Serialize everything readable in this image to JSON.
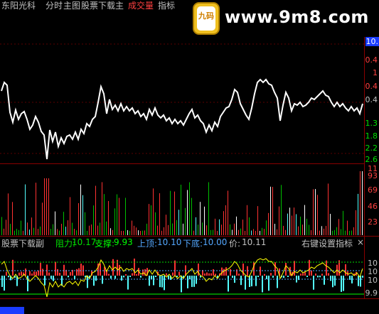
{
  "stock_name": "东阳光科",
  "menu": {
    "fenshi": "分时",
    "zhutu": "主图",
    "main_indicator_name": "股票下载主",
    "volume_label": "成交量",
    "indicator_label": "指标"
  },
  "watermark": {
    "site": "www.9m8.com",
    "badge_text": "九码"
  },
  "price_axis": {
    "current_value": "10.",
    "ticks": [
      "0.4",
      "1",
      "0.4",
      "0.4",
      "1.3",
      "1.8",
      "2.2",
      "2.6"
    ]
  },
  "volume_axis": {
    "ticks": [
      "11",
      "93",
      "69",
      "46",
      "23"
    ]
  },
  "indicator": {
    "name": "股票下载副",
    "resistance_label": "阻力:",
    "resistance_value": "10.17",
    "support_label": "支撑:",
    "support_value": "9.93",
    "top_label": "上顶:",
    "top_value": "10.10",
    "bottom_label": "下底:",
    "bottom_value": "10.00",
    "price_label": "价:",
    "price_value": "10.11",
    "settings_hint": "右键设置指标",
    "close_symbol": "×",
    "axis_ticks": [
      "10",
      "10",
      "10",
      "9.9"
    ]
  },
  "colors": {
    "background": "#000000",
    "price_line": "#ffffff",
    "up_bar": "#ff3232",
    "down_bar": "#54ffff",
    "volume_green": "#00c000",
    "axis_red": "#ff4040",
    "resistance": "#00e000",
    "support": "#00ff00",
    "top": "#54a8ff",
    "bottom": "#54a8ff",
    "yellow_line": "#ffff00",
    "grid_red": "#8a0000"
  }
}
